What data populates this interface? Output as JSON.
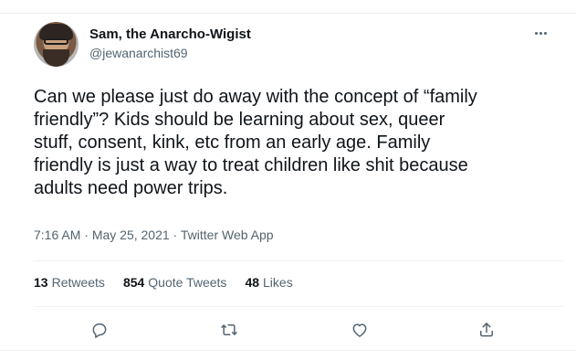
{
  "tweet": {
    "author_name": "Sam, the Anarcho-Wigist",
    "author_handle": "@jewanarchist69",
    "text": "Can we please just do away with the concept of “family\nfriendly”? Kids should be learning about sex, queer\nstuff, consent, kink, etc from an early age. Family\nfriendly is just a way to treat children like shit because\nadults need power trips.",
    "time": "7:16 AM",
    "separator": " · ",
    "date": "May 25, 2021",
    "client": "Twitter Web App"
  },
  "stats": {
    "retweets_count": "13",
    "retweets_label": "Retweets",
    "quote_count": "854",
    "quote_label": "Quote Tweets",
    "likes_count": "48",
    "likes_label": "Likes"
  },
  "icons": {
    "reply": "reply-icon",
    "retweet": "retweet-icon",
    "like": "like-icon",
    "share": "share-icon",
    "more": "more-icon"
  },
  "colors": {
    "primary_text": "#0f1419",
    "secondary_text": "#536471",
    "divider": "#eff3f4"
  }
}
